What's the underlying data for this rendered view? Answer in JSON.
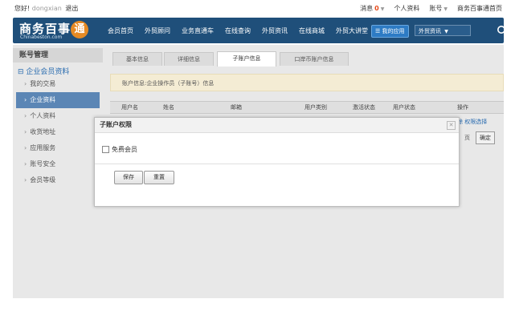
{
  "topbar": {
    "greeting": "您好!",
    "username": "dongxian",
    "logout": "退出",
    "messages_label": "消息",
    "messages_count": "0",
    "profile": "个人资料",
    "account": "账号",
    "home": "商务百事通首页"
  },
  "header": {
    "logo_cn": "商务百事",
    "logo_seal": "通",
    "logo_en": "Chinabeston.com",
    "nav": [
      "会员首页",
      "外贸顾问",
      "业务直通车",
      "在线查询",
      "外贸资讯",
      "在线商城",
      "外贸大讲堂"
    ],
    "my_app": "我的应用",
    "search_select": "外贸资讯"
  },
  "sidebar": {
    "title": "账号管理",
    "group": "企业会员资料",
    "items": [
      "我的交易",
      "企业资料",
      "个人资料",
      "收货地址",
      "应用服务",
      "账号安全",
      "会员等级"
    ],
    "active_index": 1
  },
  "tabs": [
    "基本信息",
    "详细信息",
    "子账户信息",
    "口岸币账户信息"
  ],
  "active_tab": 2,
  "infobar": "账户信息:企业操作员（子账号）信息",
  "table": {
    "headers": [
      "用户名",
      "姓名",
      "邮箱",
      "用户类别",
      "激活状态",
      "用户状态",
      "操作"
    ]
  },
  "behind_fragments": {
    "op_link": "除 权限选择",
    "page": "页",
    "confirm": "确定"
  },
  "modal": {
    "title": "子账户权限",
    "checkbox_label": "免费会员",
    "save": "保存",
    "reset": "重置"
  }
}
